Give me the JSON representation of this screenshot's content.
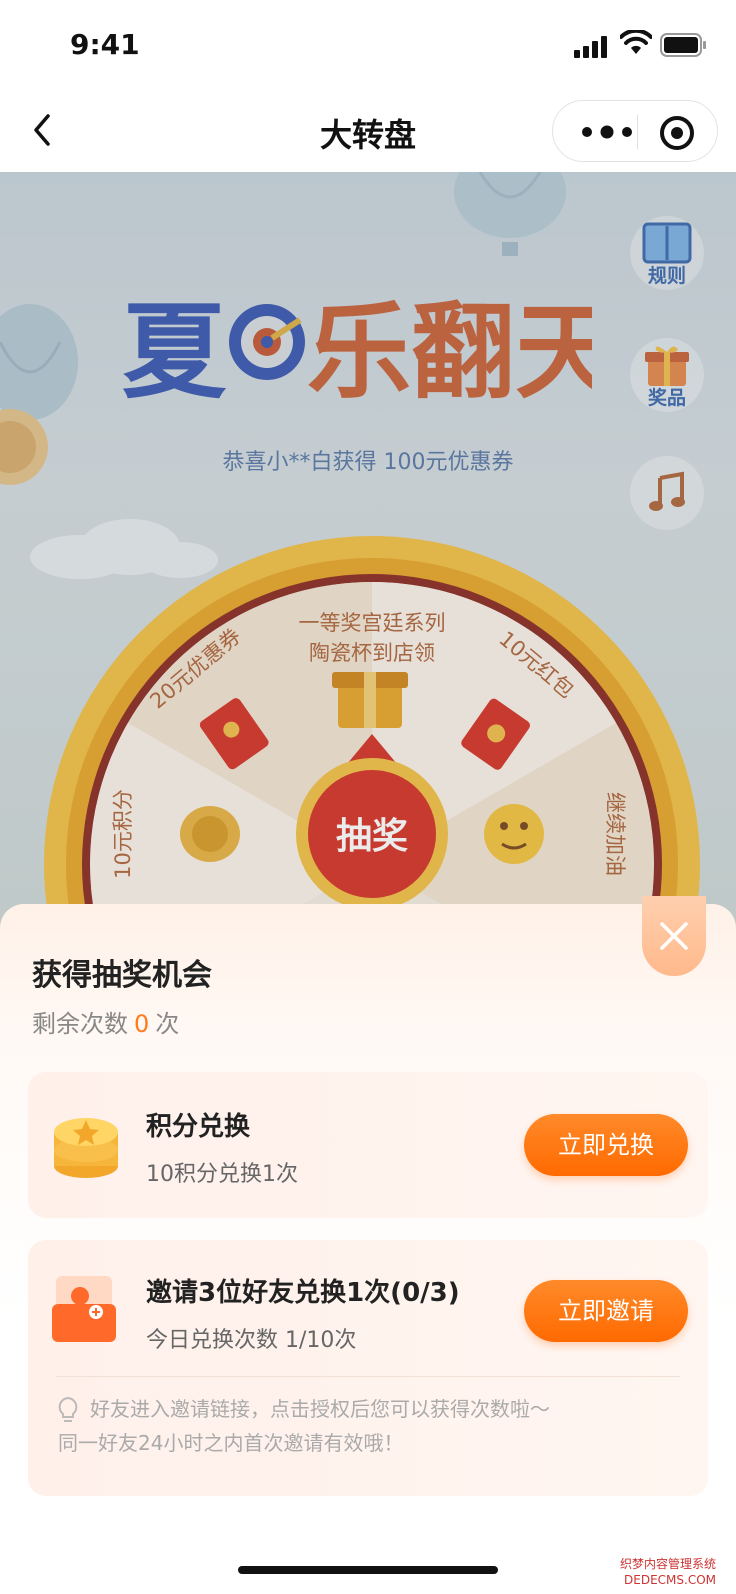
{
  "status_bar": {
    "time": "9:41"
  },
  "nav": {
    "title": "大转盘"
  },
  "game": {
    "ticker": "恭喜小**白获得 100元优惠券",
    "side_buttons": [
      {
        "label": "规则",
        "icon": "rules-book-icon"
      },
      {
        "label": "奖品",
        "icon": "gift-box-icon"
      },
      {
        "label": "",
        "icon": "music-note-icon"
      }
    ],
    "wheel": {
      "segments": [
        "一等奖宫廷系列",
        "陶瓷杯到店领",
        "10元红包",
        "继续加油",
        "20元优惠券",
        "10元积分"
      ],
      "center_button": "抽奖"
    }
  },
  "sheet": {
    "title": "获得抽奖机会",
    "remain_prefix": "剩余次数",
    "remain_count": "0",
    "remain_suffix": "次",
    "cards": [
      {
        "title": "积分兑换",
        "subtitle": "10积分兑换1次",
        "button": "立即兑换",
        "icon": "coin-stack-icon"
      },
      {
        "title": "邀请3位好友兑换1次(0/3)",
        "subtitle": "今日兑换次数 1/10次",
        "button": "立即邀请",
        "icon": "invite-friend-icon",
        "tips": [
          "好友进入邀请链接，点击授权后您可以获得次数啦～",
          "同一好友24小时之内首次邀请有效哦！"
        ]
      }
    ]
  },
  "watermark": {
    "line1": "织梦内容管理系统",
    "line2": "DEDECMS.COM"
  },
  "colors": {
    "accent": "#ff6a00",
    "count_highlight": "#ff7b1c",
    "ticker": "#5b7aa8"
  }
}
